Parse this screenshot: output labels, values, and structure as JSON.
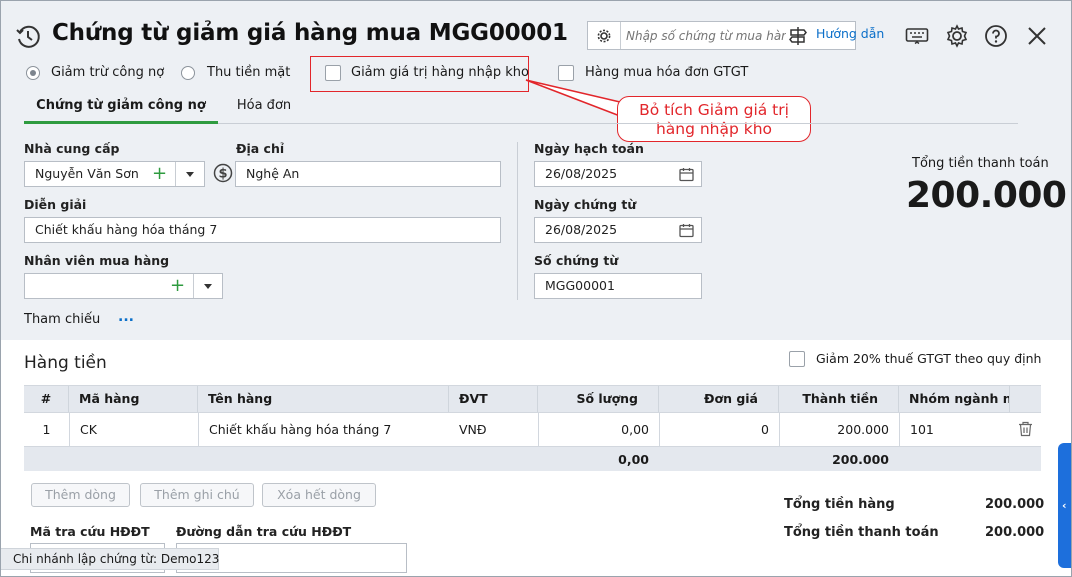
{
  "header": {
    "title": "Chứng từ giảm giá hàng mua MGG00001",
    "search_placeholder": "Nhập số chứng từ mua hàng",
    "guide_label": "Hướng dẫn"
  },
  "options": {
    "radio_debt": "Giảm trừ công nợ",
    "radio_cash": "Thu tiền mặt",
    "check_inventory": "Giảm giá trị hàng nhập kho",
    "check_vat": "Hàng mua hóa đơn GTGT"
  },
  "callout": {
    "line1": "Bỏ tích Giảm giá trị",
    "line2": "hàng nhập kho"
  },
  "tabs": [
    {
      "label": "Chứng từ giảm công nợ"
    },
    {
      "label": "Hóa đơn"
    }
  ],
  "form": {
    "supplier_label": "Nhà cung cấp",
    "supplier_value": "Nguyễn Văn Sơn",
    "address_label": "Địa chỉ",
    "address_value": "Nghệ An",
    "desc_label": "Diễn giải",
    "desc_value": "Chiết khấu hàng hóa tháng 7",
    "buyer_label": "Nhân viên mua hàng",
    "buyer_value": "",
    "reference_label": "Tham chiếu",
    "reference_more": "...",
    "posting_date_label": "Ngày hạch toán",
    "posting_date_value": "26/08/2025",
    "voucher_date_label": "Ngày chứng từ",
    "voucher_date_value": "26/08/2025",
    "voucher_no_label": "Số chứng từ",
    "voucher_no_value": "MGG00001"
  },
  "total": {
    "label": "Tổng tiền thanh toán",
    "value": "200.000"
  },
  "section": {
    "title": "Hàng tiền",
    "vat_reduce_label": "Giảm 20% thuế GTGT theo quy định"
  },
  "grid": {
    "columns": [
      "#",
      "Mã hàng",
      "Tên hàng",
      "ĐVT",
      "Số lượng",
      "Đơn giá",
      "Thành tiền",
      "Nhóm ngành ngh"
    ],
    "rows": [
      [
        "1",
        "CK",
        "Chiết khấu hàng hóa tháng 7",
        "VNĐ",
        "0,00",
        "0",
        "200.000",
        "101"
      ]
    ],
    "footer": {
      "quantity": "0,00",
      "amount": "200.000"
    }
  },
  "buttons": {
    "add_row": "Thêm dòng",
    "add_note": "Thêm ghi chú",
    "delete_all": "Xóa hết dòng"
  },
  "lookup": {
    "code_label": "Mã tra cứu HĐĐT",
    "url_label": "Đường dẫn tra cứu HĐĐT"
  },
  "summary": {
    "goods_total_label": "Tổng tiền hàng",
    "goods_total_value": "200.000",
    "pay_total_label": "Tổng tiền thanh toán",
    "pay_total_value": "200.000"
  },
  "status": {
    "branch": "Chi nhánh lập chứng từ: Demo123"
  },
  "colors": {
    "accent_green": "#2e9b3f",
    "link_blue": "#0b6fc9",
    "callout_red": "#e2262b",
    "side_tab_blue": "#1d6fdc"
  }
}
